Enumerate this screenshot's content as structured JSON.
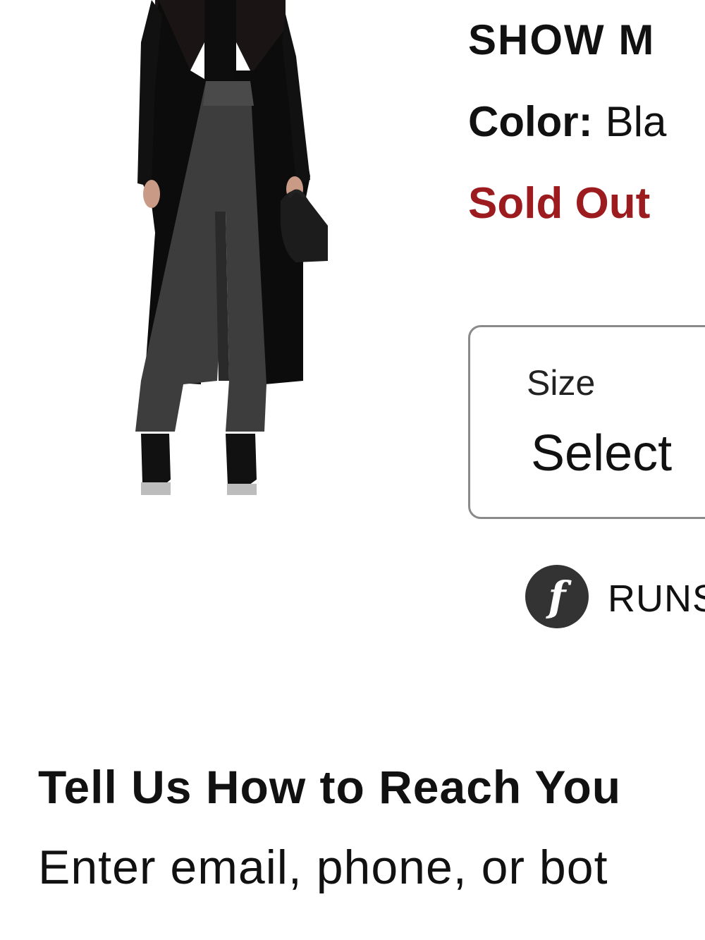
{
  "product": {
    "brand": "SHOW M",
    "color_label": "Color:",
    "color_value": "Bla",
    "status": "Sold Out"
  },
  "size_select": {
    "label": "Size",
    "value": "Select"
  },
  "fit_info": {
    "icon": "fit-predictor-icon",
    "text": "RUNS"
  },
  "contact": {
    "title": "Tell Us How to Reach You",
    "subtitle": "Enter email, phone, or bot"
  },
  "colors": {
    "sold_out": "#9b1b1f",
    "text": "#111111",
    "border": "#8a8a8a",
    "icon_bg": "#333333"
  }
}
